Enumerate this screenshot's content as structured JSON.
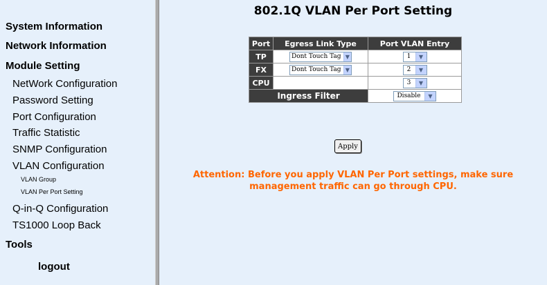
{
  "nav": {
    "system_info": "System Information",
    "network_info": "Network Information",
    "module_setting": "Module Setting",
    "network_config": "NetWork Configuration",
    "password_setting": "Password Setting",
    "port_config": "Port Configuration",
    "traffic_stat": "Traffic Statistic",
    "snmp_config": "SNMP Configuration",
    "vlan_config": "VLAN Configuration",
    "vlan_group": "VLAN Group",
    "vlan_per_port": "VLAN Per Port Setting",
    "qinq_config": "Q-in-Q Configuration",
    "loop_back": "TS1000 Loop Back",
    "tools": "Tools",
    "logout": "logout"
  },
  "page": {
    "title": "802.1Q VLAN Per Port Setting",
    "headers": {
      "port": "Port",
      "egress": "Egress Link Type",
      "vlan_entry": "Port VLAN Entry"
    },
    "rows": {
      "tp": {
        "port": "TP",
        "egress": "Dont Touch Tag",
        "vlan": "1"
      },
      "fx": {
        "port": "FX",
        "egress": "Dont Touch Tag",
        "vlan": "2"
      },
      "cpu": {
        "port": "CPU",
        "vlan": "3"
      }
    },
    "ingress_label": "Ingress Filter",
    "ingress_value": "Disable",
    "apply_label": "Apply",
    "attention": "Attention: Before you apply VLAN Per Port settings, make sure management traffic can go through CPU."
  },
  "colors": {
    "attention": "#ff6600",
    "header_bg": "#3d3d3d",
    "panel_bg": "#e6f0fb"
  },
  "icons": {
    "dropdown": "chevron-down-icon"
  }
}
